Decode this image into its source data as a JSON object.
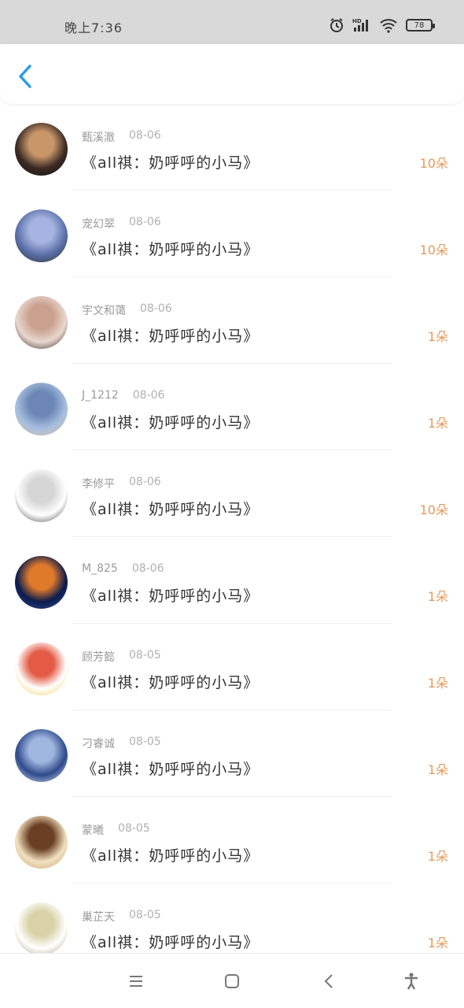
{
  "status": {
    "time": "晚上7:36",
    "battery": "78"
  },
  "rows": [
    {
      "name": "甄溪澈",
      "date": "08-06",
      "title": "《all祺：奶呼呼的小马》",
      "count": "10朵",
      "palette": [
        "#3a2a22",
        "#c9966a",
        "#111"
      ]
    },
    {
      "name": "宠幻翠",
      "date": "08-06",
      "title": "《all祺：奶呼呼的小马》",
      "count": "10朵",
      "palette": [
        "#5b6ea8",
        "#a5b4e0",
        "#27321f"
      ]
    },
    {
      "name": "宇文和蔼",
      "date": "08-06",
      "title": "《all祺：奶呼呼的小马》",
      "count": "1朵",
      "palette": [
        "#e9d7cf",
        "#caa18e",
        "#2a1c17"
      ]
    },
    {
      "name": "J_1212",
      "date": "08-06",
      "title": "《all祺：奶呼呼的小马》",
      "count": "1朵",
      "palette": [
        "#a7bedf",
        "#6c87b5",
        "#d8c2a5"
      ]
    },
    {
      "name": "李修平",
      "date": "08-06",
      "title": "《all祺：奶呼呼的小马》",
      "count": "10朵",
      "palette": [
        "#ffffff",
        "#d6d6d6",
        "#333333"
      ]
    },
    {
      "name": "M_825",
      "date": "08-06",
      "title": "《all祺：奶呼呼的小马》",
      "count": "1朵",
      "palette": [
        "#0c1b4d",
        "#e07a2b",
        "#3a55a0"
      ]
    },
    {
      "name": "顾芳懿",
      "date": "08-05",
      "title": "《all祺：奶呼呼的小马》",
      "count": "1朵",
      "palette": [
        "#ffffff",
        "#e35b45",
        "#f2c94c"
      ]
    },
    {
      "name": "刁睿诚",
      "date": "08-05",
      "title": "《all祺：奶呼呼的小马》",
      "count": "1朵",
      "palette": [
        "#2f4a8c",
        "#9fb6df",
        "#f0f4fb"
      ]
    },
    {
      "name": "蒙曦",
      "date": "08-05",
      "title": "《all祺：奶呼呼的小马》",
      "count": "1朵",
      "palette": [
        "#f1e1c0",
        "#6b3f23",
        "#c8a36d"
      ]
    },
    {
      "name": "巢芷天",
      "date": "08-05",
      "title": "《all祺：奶呼呼的小马》",
      "count": "1朵",
      "palette": [
        "#ffffff",
        "#d9d2a9",
        "#9fa070"
      ]
    }
  ]
}
